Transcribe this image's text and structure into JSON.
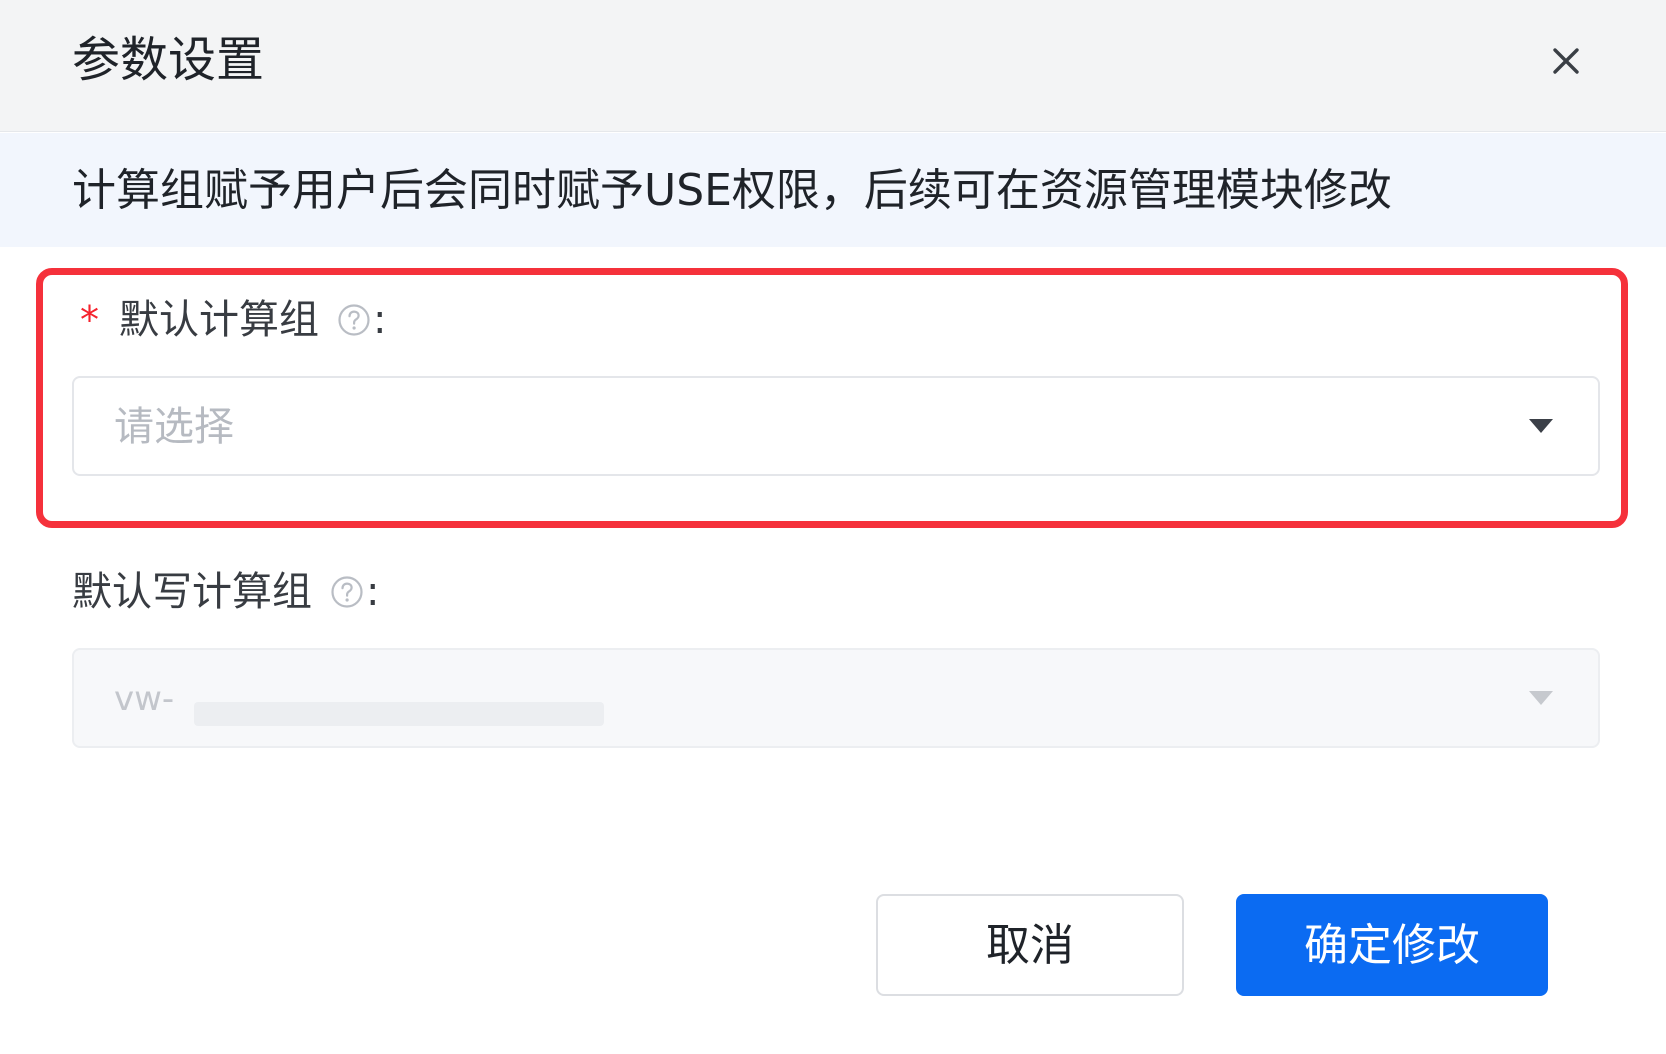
{
  "dialog": {
    "title": "参数设置",
    "close_icon": "close-icon"
  },
  "notice": {
    "text": "计算组赋予用户后会同时赋予USE权限，后续可在资源管理模块修改"
  },
  "fields": {
    "default_compute_group": {
      "required_mark": "*",
      "label": "默认计算组",
      "colon": ":",
      "help_icon": "question-circle-icon",
      "placeholder": "请选择",
      "arrow_icon": "caret-down-icon"
    },
    "default_write_compute_group": {
      "label": "默认写计算组",
      "colon": ":",
      "help_icon": "question-circle-icon",
      "value": "vw-",
      "disabled": true,
      "arrow_icon": "caret-down-icon"
    }
  },
  "footer": {
    "cancel_label": "取消",
    "confirm_label": "确定修改"
  },
  "colors": {
    "primary": "#0b6bf2",
    "highlight": "#f5313b",
    "required": "#f5222d",
    "notice_bg": "#f2f6fd",
    "header_bg": "#f3f4f5"
  }
}
